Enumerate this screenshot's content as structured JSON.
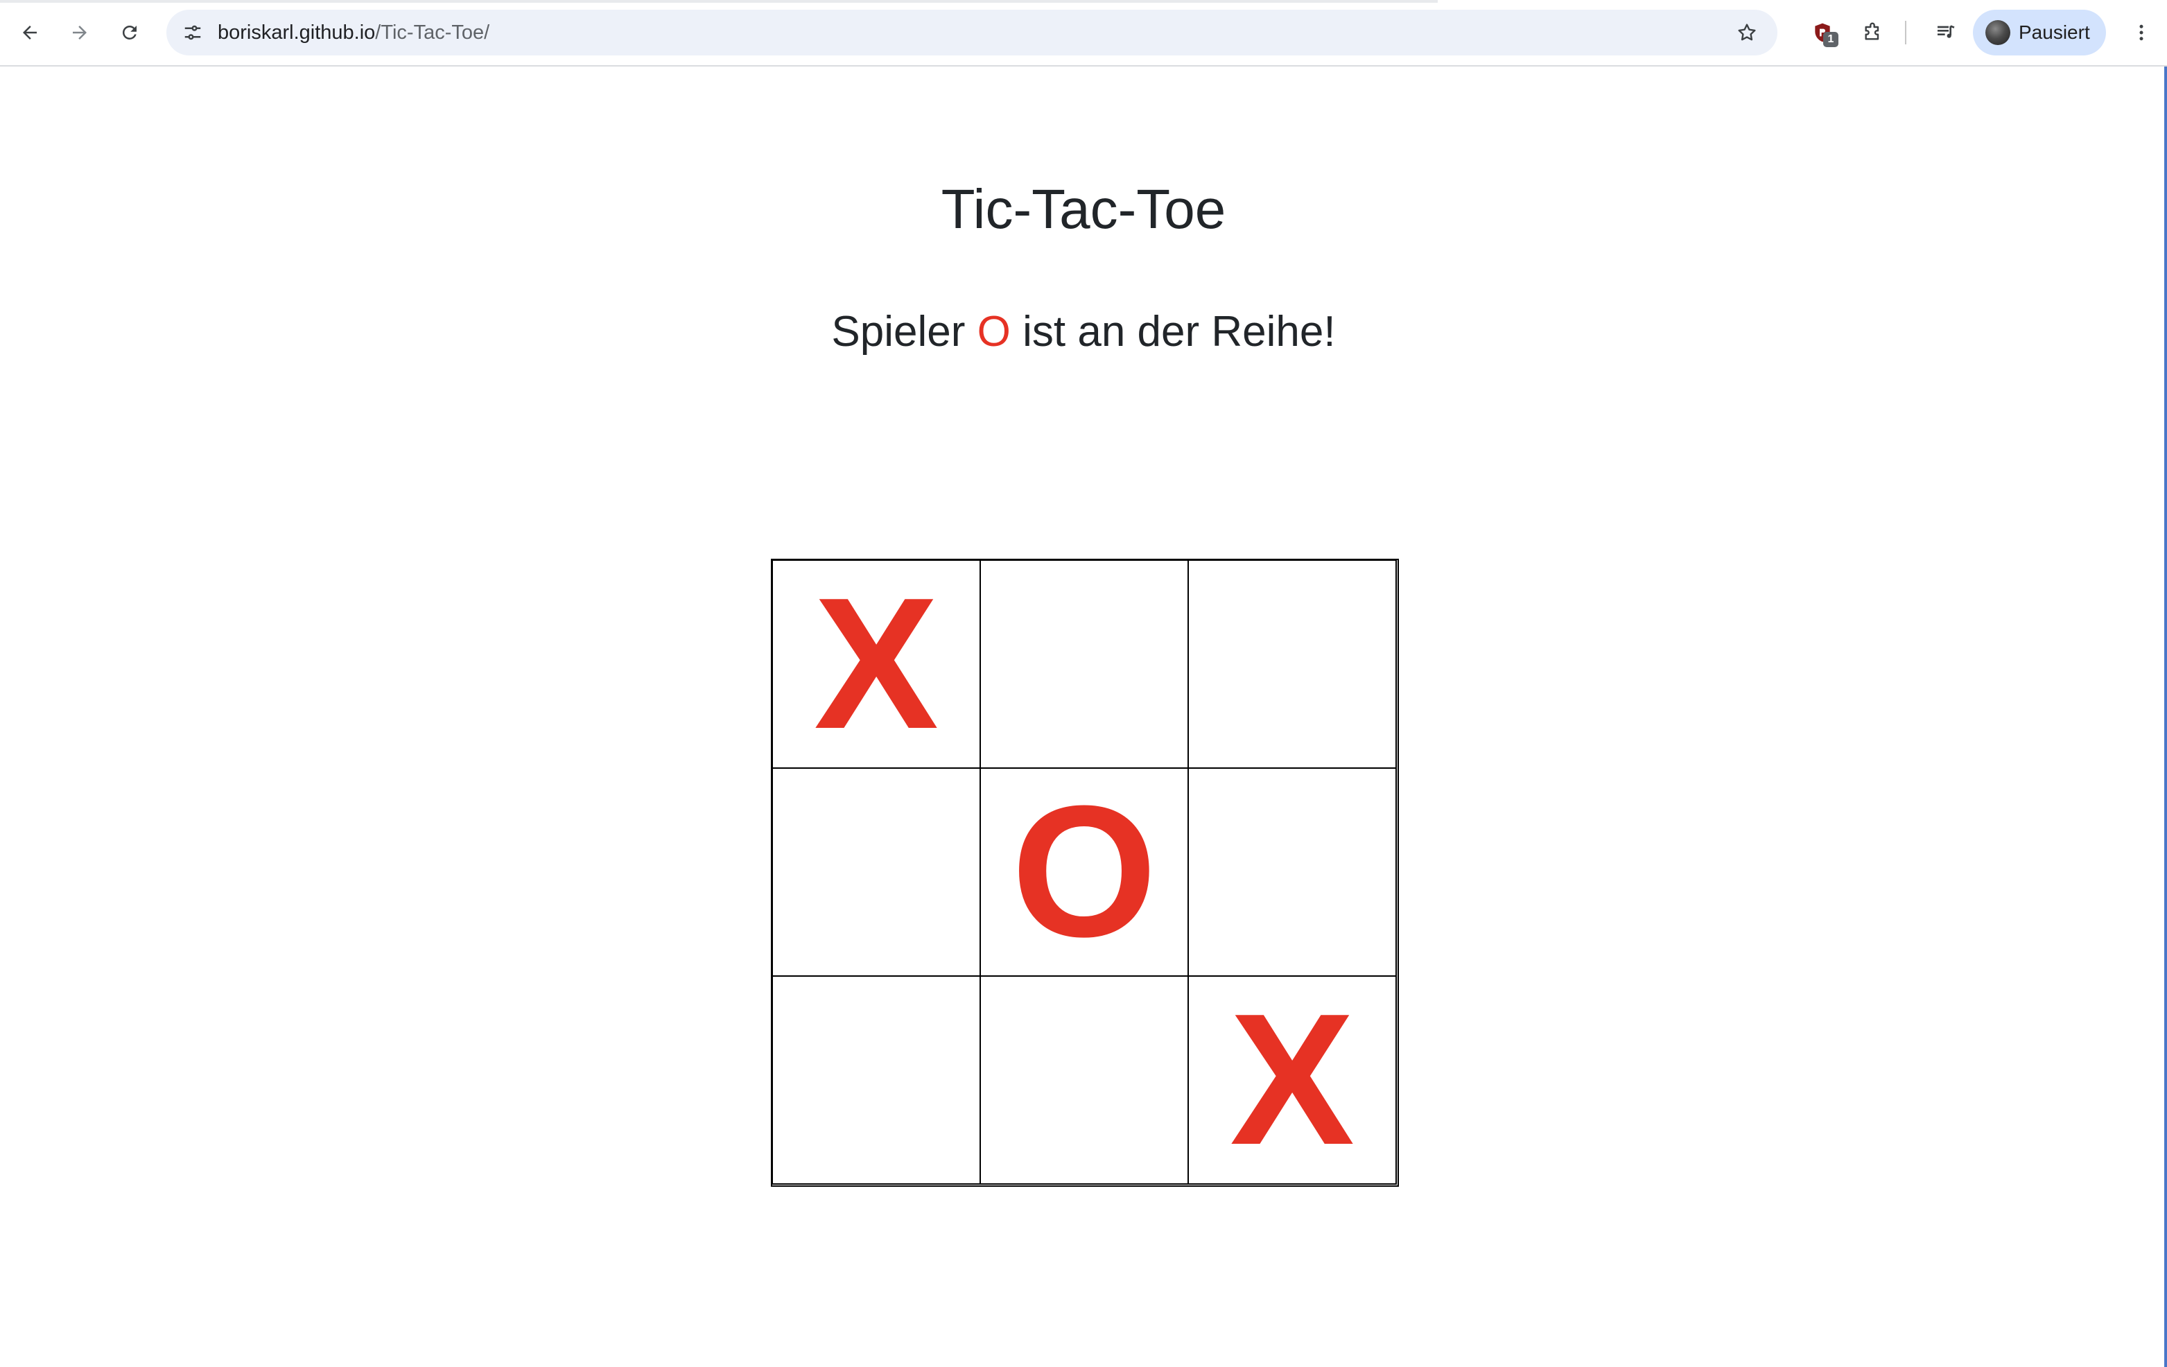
{
  "browser": {
    "url_host": "boriskarl.github.io",
    "url_path": "/Tic-Tac-Toe/",
    "extension_badge": "1",
    "profile_label": "Pausiert",
    "icons": {
      "back": "arrow-left-icon",
      "forward": "arrow-right-icon",
      "reload": "reload-icon",
      "site_info": "tune-icon",
      "bookmark": "star-icon",
      "extension": "shield-icon",
      "extensions": "puzzle-icon",
      "media": "media-queue-icon",
      "menu": "kebab-menu-icon"
    }
  },
  "page": {
    "title": "Tic-Tac-Toe",
    "status_prefix": "Spieler",
    "status_player": "O",
    "status_suffix": "ist an der Reihe!",
    "mark_color": "#e63224"
  },
  "board": {
    "cells": [
      "X",
      "",
      "",
      "",
      "O",
      "",
      "",
      "",
      "X"
    ]
  }
}
